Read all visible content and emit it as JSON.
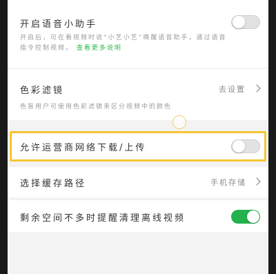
{
  "settings": {
    "voice_assistant": {
      "title": "开启语音小助手",
      "description_line1": "开启后，可在看视频时说“小艺小艺”唤醒语音助手，通过语音",
      "description_line2": "指令控制视频。",
      "link_text": "查看更多说明",
      "toggle_state": "off"
    },
    "color_filter": {
      "title": "色彩滤镜",
      "value": "去设置",
      "description": "色盲用户可使用色彩滤镜来区分视频中的颜色"
    },
    "carrier_network": {
      "title": "允许运营商网络下载/上传",
      "toggle_state": "off"
    },
    "storage_path": {
      "title": "选择缓存路径",
      "value": "手机存储"
    },
    "low_storage_reminder": {
      "title": "剩余空间不多时提醒清理离线视频",
      "toggle_state": "on"
    }
  },
  "colors": {
    "toggle_on": "#22b14c",
    "link": "#28b94a",
    "highlight": "#f6c531"
  }
}
